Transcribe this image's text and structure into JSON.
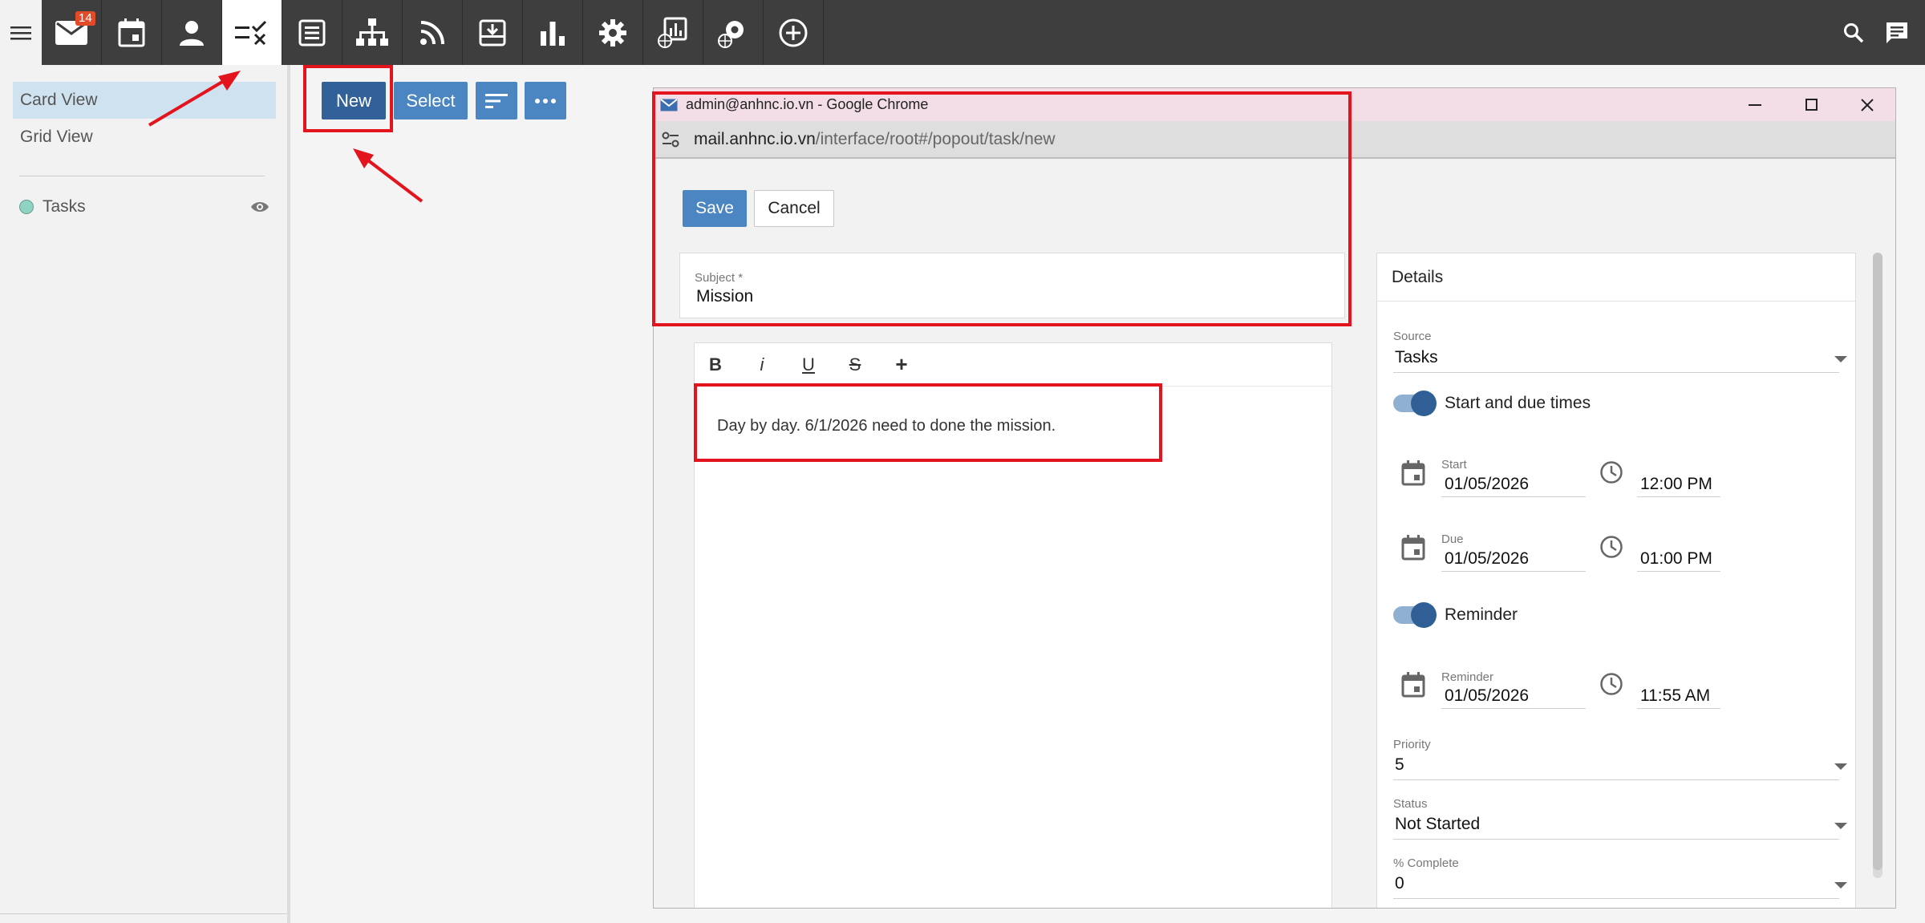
{
  "topbar": {
    "items": [
      {
        "name": "mail",
        "badge": "14"
      },
      {
        "name": "calendar"
      },
      {
        "name": "contacts"
      },
      {
        "name": "tasks"
      },
      {
        "name": "notes"
      },
      {
        "name": "organization"
      },
      {
        "name": "rss"
      },
      {
        "name": "archive"
      },
      {
        "name": "reports"
      },
      {
        "name": "settings"
      },
      {
        "name": "admin-reports"
      },
      {
        "name": "admin-settings"
      },
      {
        "name": "add"
      }
    ],
    "active_item": "tasks"
  },
  "sidebar": {
    "views": [
      "Card View",
      "Grid View"
    ],
    "active_view": "Card View",
    "folder": "Tasks"
  },
  "toolbar": {
    "new_label": "New",
    "select_label": "Select"
  },
  "popup": {
    "title": "admin@anhnc.io.vn - Google Chrome",
    "url_host": "mail.anhnc.io.vn",
    "url_path": "/interface/root#/popout/task/new",
    "save_label": "Save",
    "cancel_label": "Cancel",
    "subject_label": "Subject *",
    "subject_value": "Mission",
    "editor_tools": [
      "B",
      "i",
      "U",
      "S",
      "+"
    ],
    "body_text": "Day by day. 6/1/2026 need to done the mission.",
    "details": {
      "heading": "Details",
      "source_label": "Source",
      "source_value": "Tasks",
      "start_due_toggle_label": "Start and due times",
      "start_label": "Start",
      "start_date": "01/05/2026",
      "start_time": "12:00 PM",
      "due_label": "Due",
      "due_date": "01/05/2026",
      "due_time": "01:00 PM",
      "reminder_toggle_label": "Reminder",
      "reminder_label": "Reminder",
      "reminder_date": "01/05/2026",
      "reminder_time": "11:55 AM",
      "priority_label": "Priority",
      "priority_value": "5",
      "status_label": "Status",
      "status_value": "Not Started",
      "complete_label": "% Complete",
      "complete_value": "0"
    }
  },
  "colors": {
    "nav_bg": "#3e3e3e",
    "accent": "#4b85c2",
    "new_button": "#32619a",
    "annotation": "#e3141e",
    "toggle_knob": "#2f5f94",
    "title_bar": "#f3dde6"
  }
}
